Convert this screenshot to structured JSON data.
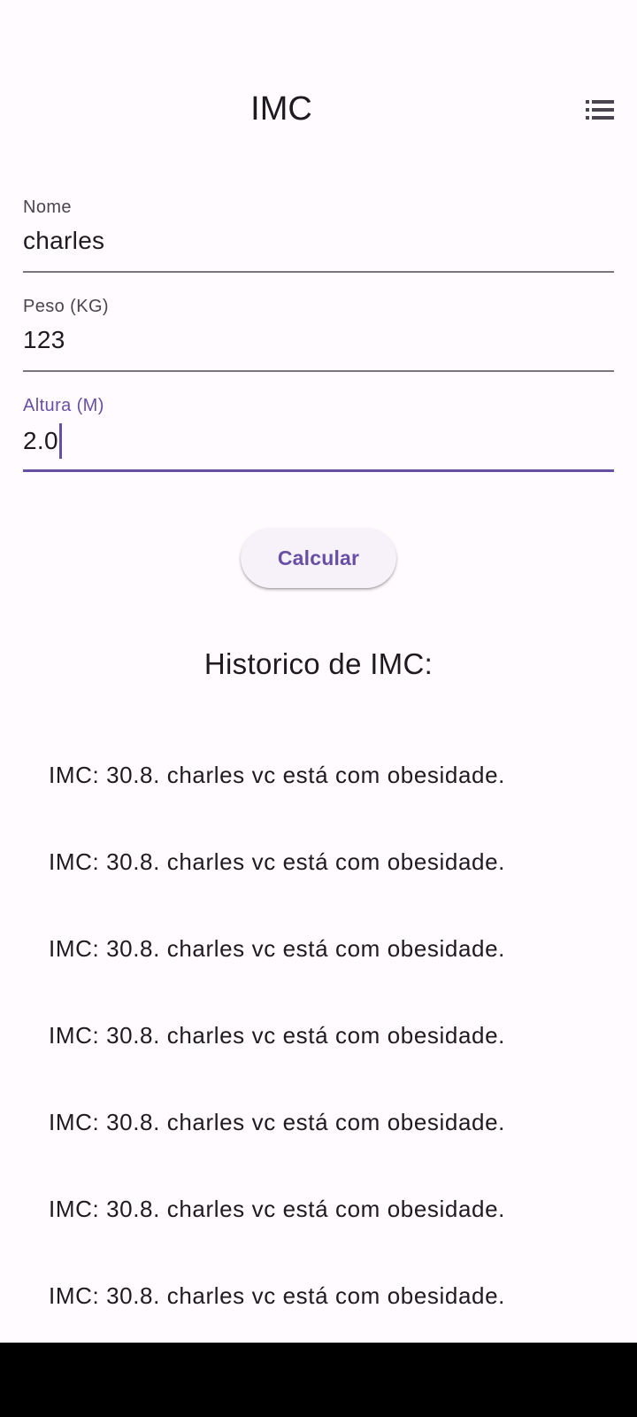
{
  "app_bar": {
    "title": "IMC",
    "action_icon": "list-icon"
  },
  "form": {
    "name": {
      "label": "Nome",
      "value": "charles"
    },
    "weight": {
      "label": "Peso (KG)",
      "value": "123"
    },
    "height": {
      "label": "Altura (M)",
      "value": "2.0",
      "focused": true
    }
  },
  "calculate_button": {
    "label": "Calcular"
  },
  "history": {
    "title": "Historico de IMC:",
    "items": [
      "IMC: 30.8. charles vc está com obesidade.",
      "IMC: 30.8. charles vc está com obesidade.",
      "IMC: 30.8. charles vc está com obesidade.",
      "IMC: 30.8. charles vc está com obesidade.",
      "IMC: 30.8. charles vc está com obesidade.",
      "IMC: 30.8. charles vc está com obesidade.",
      "IMC: 30.8. charles vc está com obesidade."
    ]
  },
  "colors": {
    "primary": "#6750a4",
    "background": "#fffbfe",
    "text": "#1d1b20",
    "label": "#49454f",
    "underline": "#79747e",
    "nav_bar": "#000000"
  }
}
